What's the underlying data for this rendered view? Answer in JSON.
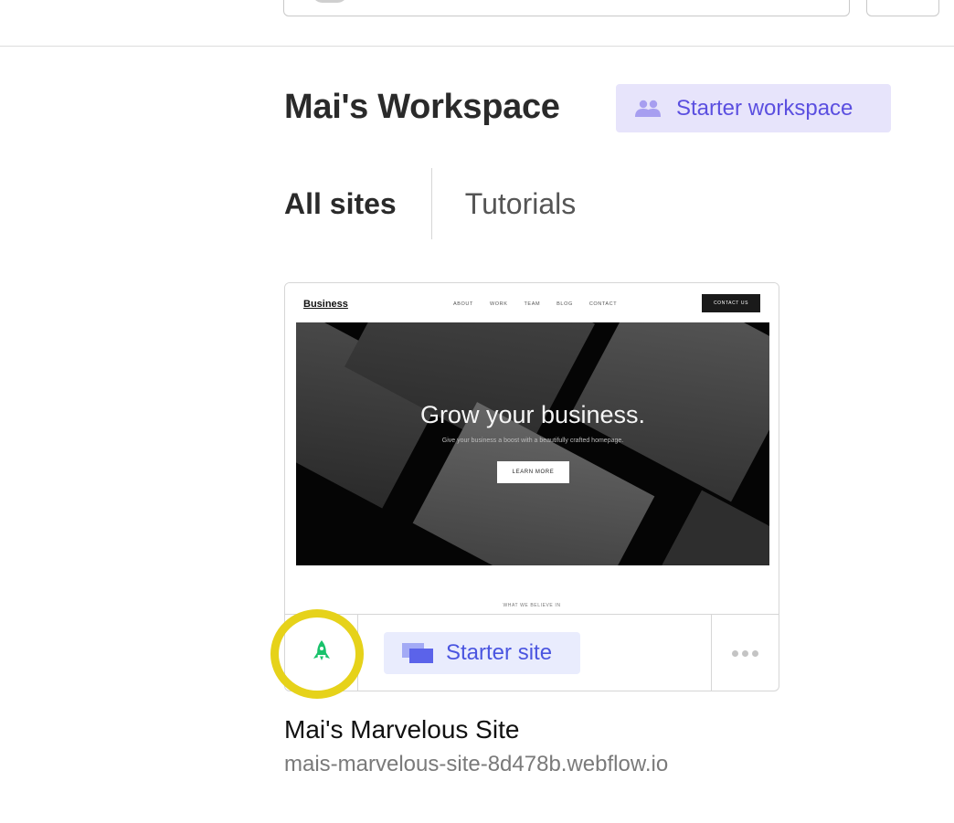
{
  "workspace": {
    "title": "Mai's Workspace",
    "badge_label": "Starter workspace",
    "badge_icon": "people-icon",
    "badge_color": "#5b4fe0",
    "badge_bg": "#e7e4fb"
  },
  "tabs": [
    {
      "label": "All sites",
      "active": true
    },
    {
      "label": "Tutorials",
      "active": false
    }
  ],
  "site": {
    "name": "Mai's Marvelous Site",
    "url": "mais-marvelous-site-8d478b.webflow.io",
    "status_icon": "rocket-icon",
    "status_color": "#19c26b",
    "plan_label": "Starter site",
    "plan_icon": "site-stack-icon",
    "more_icon": "more-dots-icon",
    "preview": {
      "logo": "Business",
      "nav_links": [
        "ABOUT",
        "WORK",
        "TEAM",
        "BLOG",
        "CONTACT"
      ],
      "cta": "CONTACT US",
      "headline": "Grow your business.",
      "subtext": "Give your business a boost with a beautifully crafted homepage.",
      "button": "LEARN MORE",
      "section_label": "WHAT WE BELIEVE IN"
    }
  },
  "highlight_color": "#e6d21a"
}
